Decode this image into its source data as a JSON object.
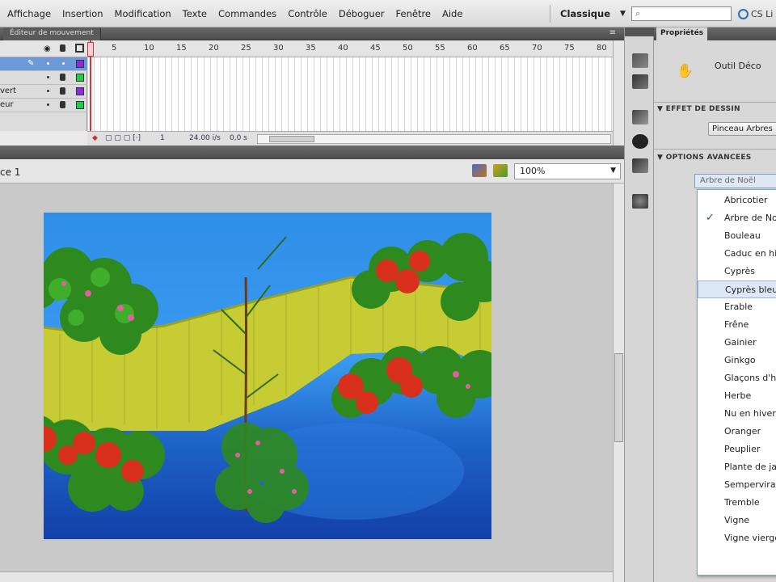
{
  "menubar": {
    "items": [
      "Affichage",
      "Insertion",
      "Modification",
      "Texte",
      "Commandes",
      "Contrôle",
      "Déboguer",
      "Fenêtre",
      "Aide"
    ],
    "workspace": "Classique",
    "cslive": "CS Li"
  },
  "timeline": {
    "tab": "Éditeur de mouvement",
    "ruler_ticks": [
      "5",
      "10",
      "15",
      "20",
      "25",
      "30",
      "35",
      "40",
      "45",
      "50",
      "55",
      "60",
      "65",
      "70",
      "75",
      "80"
    ],
    "layers": [
      {
        "name": "",
        "color": "#8a2be2"
      },
      {
        "name": "",
        "color": "#22cc44"
      },
      {
        "name": "vert",
        "color": "#8a2be2"
      },
      {
        "name": "eur",
        "color": "#22cc44"
      }
    ],
    "status": {
      "frame": "1",
      "fps": "24.00 i/s",
      "time": "0,0 s"
    }
  },
  "stage_bar": {
    "scene": "ce 1",
    "zoom": "100%"
  },
  "properties": {
    "tab": "Propriétés",
    "tool_name": "Outil Déco",
    "section_drawing": "EFFET DE DESSIN",
    "brush_button": "Pinceau Arbres",
    "section_advanced": "OPTIONS AVANCEES",
    "dropdown_selected": "Arbre de Noël",
    "dropdown_items": [
      {
        "label": "Abricotier",
        "checked": false,
        "highlighted": false
      },
      {
        "label": "Arbre de Noël",
        "checked": true,
        "highlighted": false
      },
      {
        "label": "Bouleau",
        "checked": false,
        "highlighted": false
      },
      {
        "label": "Caduc en hiver",
        "checked": false,
        "highlighted": false
      },
      {
        "label": "Cyprès",
        "checked": false,
        "highlighted": false
      },
      {
        "label": "Cyprès bleu",
        "checked": false,
        "highlighted": true
      },
      {
        "label": "Erable",
        "checked": false,
        "highlighted": false
      },
      {
        "label": "Frêne",
        "checked": false,
        "highlighted": false
      },
      {
        "label": "Gainier",
        "checked": false,
        "highlighted": false
      },
      {
        "label": "Ginkgo",
        "checked": false,
        "highlighted": false
      },
      {
        "label": "Glaçons d'hiver",
        "checked": false,
        "highlighted": false
      },
      {
        "label": "Herbe",
        "checked": false,
        "highlighted": false
      },
      {
        "label": "Nu en hiver",
        "checked": false,
        "highlighted": false
      },
      {
        "label": "Oranger",
        "checked": false,
        "highlighted": false
      },
      {
        "label": "Peuplier",
        "checked": false,
        "highlighted": false
      },
      {
        "label": "Plante de jardin",
        "checked": false,
        "highlighted": false
      },
      {
        "label": "Sempervirant",
        "checked": false,
        "highlighted": false
      },
      {
        "label": "Tremble",
        "checked": false,
        "highlighted": false
      },
      {
        "label": "Vigne",
        "checked": false,
        "highlighted": false
      },
      {
        "label": "Vigne vierge",
        "checked": false,
        "highlighted": false
      }
    ]
  },
  "colors": {
    "accent": "#2a6fb5",
    "stage_sky": "#2f8fe8",
    "playhead": "#e03030"
  }
}
